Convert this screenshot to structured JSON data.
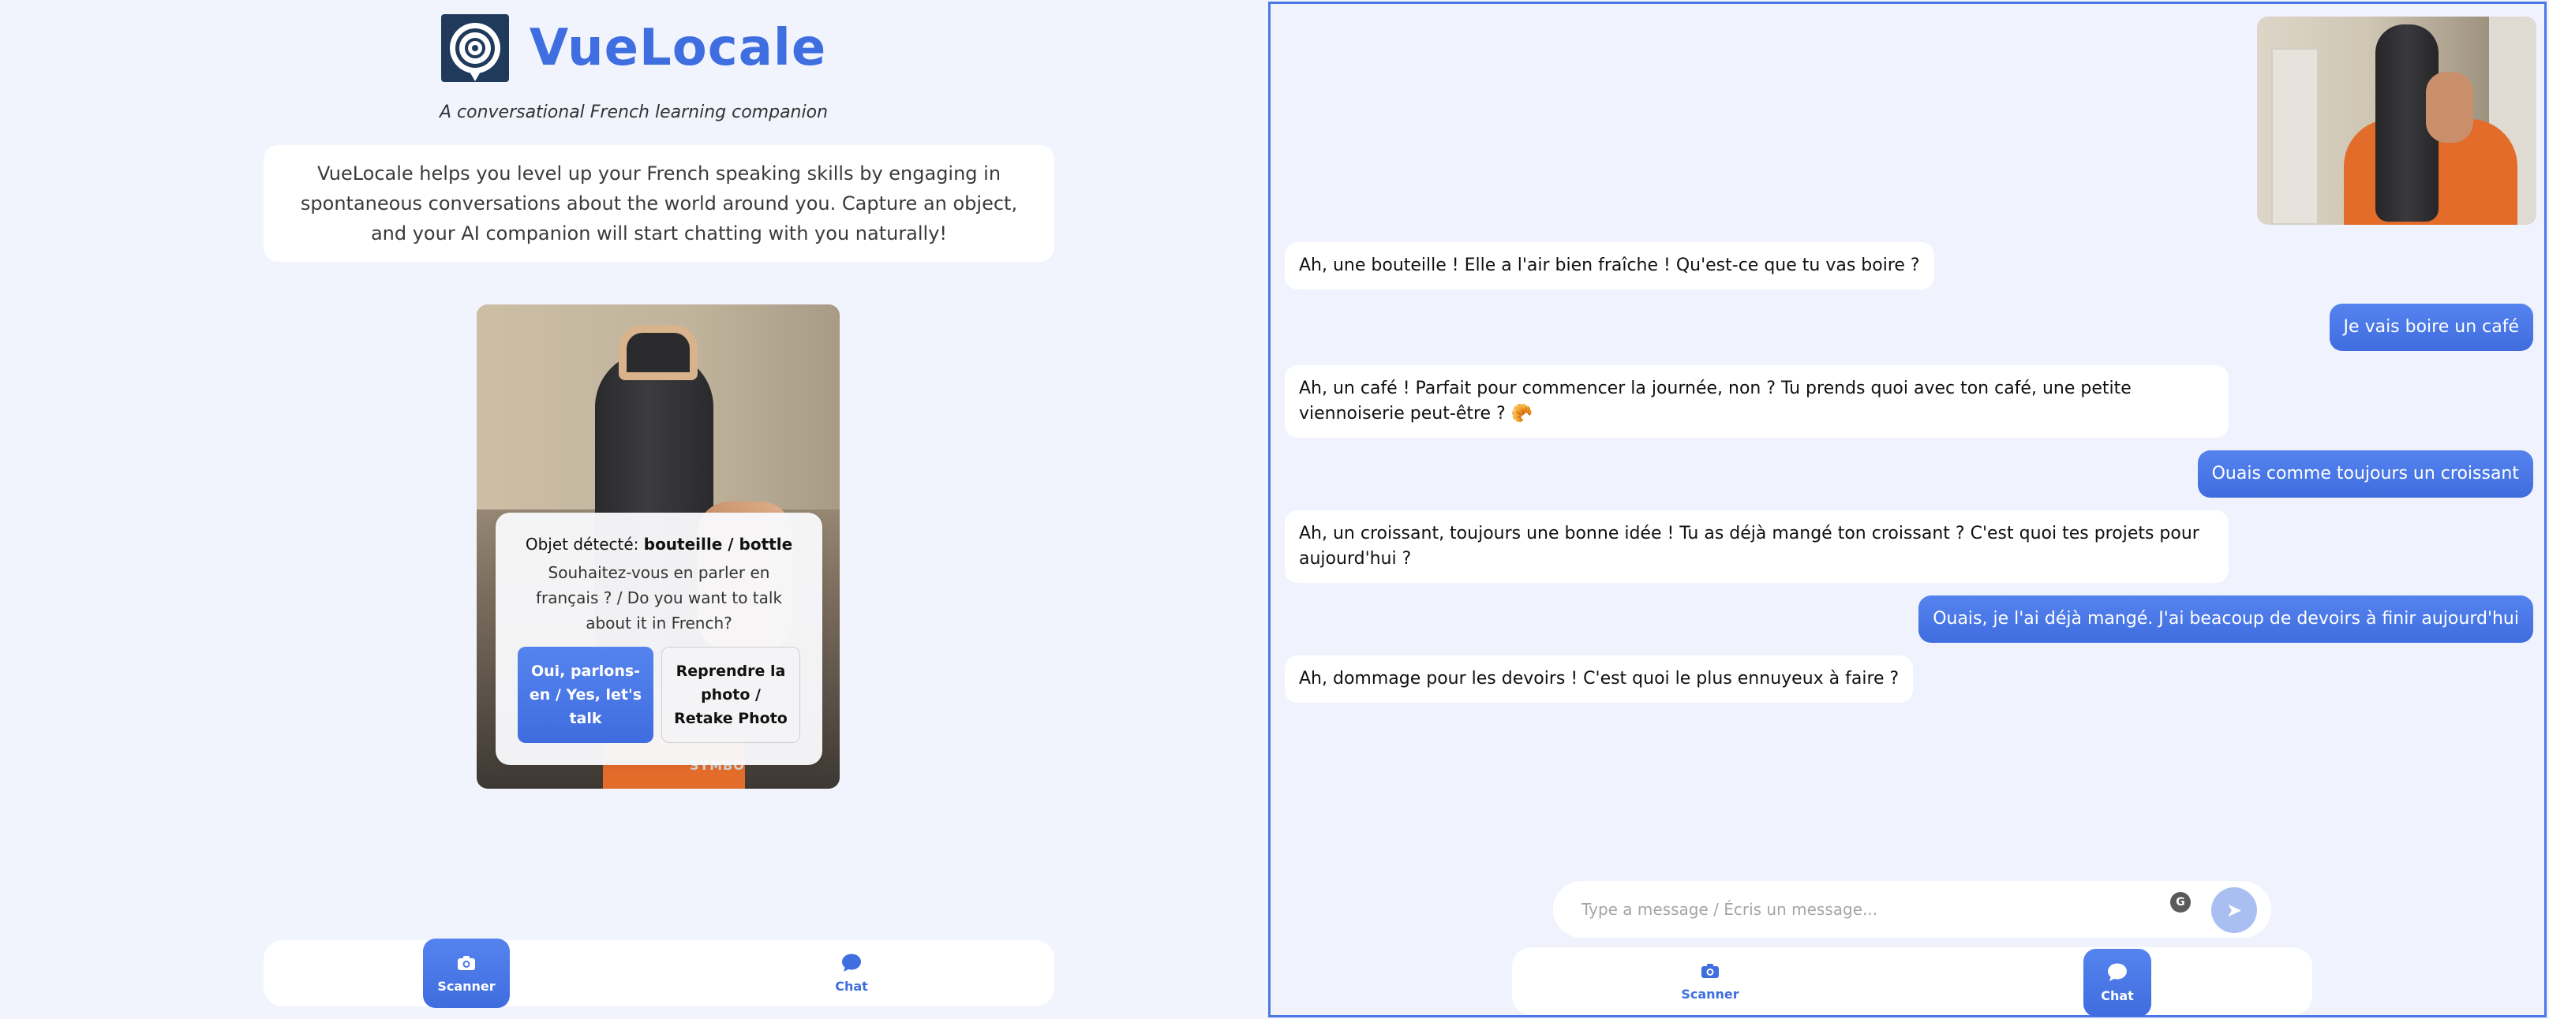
{
  "app": {
    "name": "VueLocale",
    "tagline": "A conversational French learning companion",
    "intro": "VueLocale helps you level up your French speaking skills by engaging in spontaneous conversations about the world around you. Capture an object, and your AI companion will start chatting with you naturally!"
  },
  "camera": {
    "shirt_text": "SYMBO"
  },
  "detection": {
    "prefix": "Objet détecté: ",
    "object": "bouteille / bottle",
    "question": "Souhaitez-vous en parler en français ? / Do you want to talk about it in French?",
    "confirm_label": "Oui, parlons-en / Yes, let's talk",
    "retake_label": "Reprendre la photo / Retake Photo"
  },
  "tabs": {
    "scanner": "Scanner",
    "chat": "Chat"
  },
  "chat": {
    "messages": [
      {
        "role": "ai",
        "text": "Ah, une bouteille ! Elle a l'air bien fraîche ! Qu'est-ce que tu vas boire ?"
      },
      {
        "role": "user",
        "text": "Je vais boire un café"
      },
      {
        "role": "ai",
        "text": "Ah, un café ! Parfait pour commencer la journée, non ? Tu prends quoi avec ton café, une petite viennoiserie peut-être ? 🥐"
      },
      {
        "role": "user",
        "text": "Ouais comme toujours un croissant"
      },
      {
        "role": "ai",
        "text": "Ah, un croissant, toujours une bonne idée ! Tu as déjà mangé ton croissant ? C'est quoi tes projets pour aujourd'hui ?"
      },
      {
        "role": "user",
        "text": "Ouais, je l'ai déjà mangé. J'ai beacoup de devoirs à finir aujourd'hui"
      },
      {
        "role": "ai",
        "text": "Ah, dommage pour les devoirs ! C'est quoi le plus ennuyeux à faire ?"
      }
    ],
    "input_placeholder": "Type a message / Écris un message...",
    "input_value": "",
    "send_icon": "➤",
    "grammar_icon": "G"
  },
  "colors": {
    "accent": "#3e6ee0",
    "panel_bg": "#f1f4fd",
    "border": "#4b78e6"
  }
}
